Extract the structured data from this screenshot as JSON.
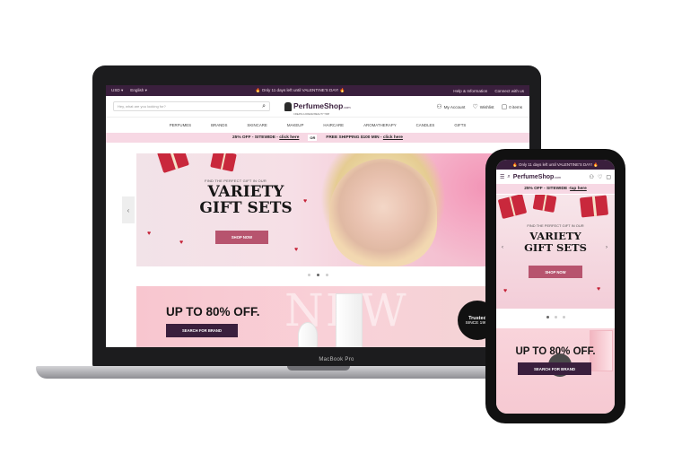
{
  "desktop": {
    "topbar": {
      "currency": "USD",
      "language": "English",
      "announcement": "🔥 Only 11 days left until VALENTINE'S DAY! 🔥",
      "help": "Help & Information",
      "connect": "Connect with us"
    },
    "header": {
      "search_placeholder": "Hey, what are you looking for?",
      "logo_name": "PerfumeShop",
      "logo_dotcom": ".com",
      "logo_tagline": "CREATE A DREAM BEAUTY TRIP",
      "account": "My Account",
      "wishlist": "Wishlist",
      "cart": "0 items"
    },
    "nav": [
      "PERFUMES",
      "BRANDS",
      "SKINCARE",
      "MAKEUP",
      "HAIRCARE",
      "AROMATHERAPY",
      "CANDLES",
      "GIFTS"
    ],
    "promo": {
      "left": "25% OFF - SITEWIDE - ",
      "left_link": "click here",
      "sep": "OR",
      "right": "FREE SHIPPING $100 MIN - ",
      "right_link": "click here"
    },
    "hero": {
      "kicker": "FIND THE PERFECT GIFT IN OUR",
      "title_line1": "VARIETY",
      "title_line2": "GIFT SETS",
      "button": "SHOP NOW",
      "prev_arrow": "‹"
    },
    "banner2": {
      "title": "UP TO 80% OFF.",
      "button": "SEARCH FOR BRAND",
      "bg_word": "NEW",
      "trusted": "Trusted",
      "since": "SINCE 1997"
    },
    "device_label": "MacBook Pro"
  },
  "mobile": {
    "topbar": "🔥 Only 11 days left until VALENTINE'S DAY! 🔥",
    "logo_name": "PerfumeShop",
    "logo_dotcom": ".com",
    "promo": "25% OFF - SITEWIDE - ",
    "promo_link": "tap here",
    "hero": {
      "kicker": "FIND THE PERFECT GIFT IN OUR",
      "title_line1": "VARIETY",
      "title_line2": "GIFT SETS",
      "button": "SHOP NOW",
      "prev_arrow": "‹",
      "next_arrow": "›"
    },
    "banner": {
      "title": "UP TO 80% OFF.",
      "trusted": "Trusted",
      "button": "SEARCH FOR BRAND"
    }
  },
  "icons": {
    "search": "⌕",
    "user": "👤",
    "heart": "♡",
    "bag": "🛍",
    "menu": "☰",
    "chevron": "▾"
  },
  "colors": {
    "brand_plum": "#3a1f3d",
    "promo_pink": "#f7d8e4",
    "cta_rose": "#b7546e"
  }
}
